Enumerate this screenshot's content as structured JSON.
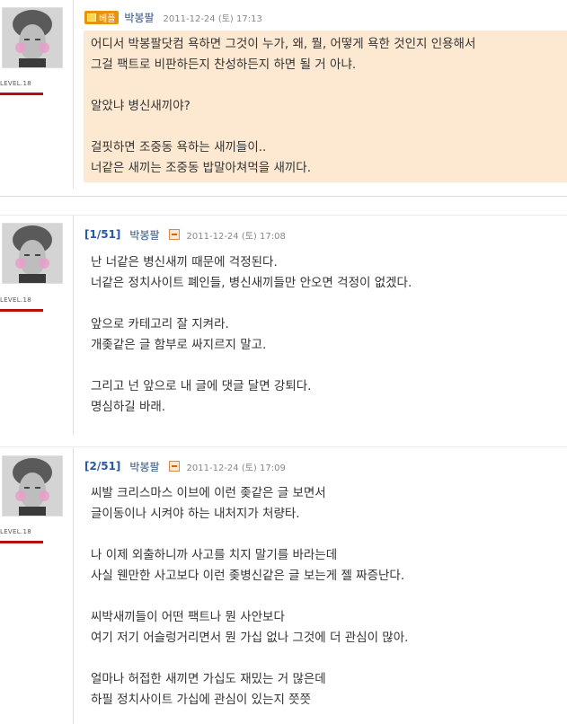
{
  "posts": [
    {
      "badge": "베플",
      "author": "박봉팔",
      "date": "2011-12-24 (토) 17:13",
      "level": "LEVEL.18",
      "lines": [
        "어디서 박봉팔닷컴 욕하면 그것이 누가, 왜, 뭘, 어떻게 욕한 것인지 인용해서",
        "그걸 팩트로 비판하든지 찬성하든지 하면 될 거 아냐.",
        "",
        "알았냐 병신새끼야?",
        "",
        "걸핏하면 조중동 욕하는 새끼들이..",
        "너같은 새끼는 조중동 밥말아쳐먹을 새끼다."
      ]
    },
    {
      "num": "[1/51]",
      "author": "박봉팔",
      "date": "2011-12-24 (토) 17:08",
      "level": "LEVEL.18",
      "lines": [
        "난 너같은 병신새끼 때문에 걱정된다.",
        "너같은 정치사이트 폐인들, 병신새끼들만 안오면 걱정이 없겠다.",
        "",
        "앞으로 카테고리 잘 지켜라.",
        "개좆같은 글 함부로 싸지르지 말고.",
        "",
        "그리고 넌 앞으로 내 글에 댓글 달면 강퇴다.",
        "명심하길 바래."
      ]
    },
    {
      "num": "[2/51]",
      "author": "박봉팔",
      "date": "2011-12-24 (토) 17:09",
      "level": "LEVEL.18",
      "lines": [
        "씨발 크리스마스 이브에 이런 좆같은 글 보면서",
        "글이동이나 시켜야 하는 내처지가 처량타.",
        "",
        "나 이제 외출하니까 사고를 치지 말기를 바라는데",
        "사실 웬만한 사고보다 이런 좆병신같은 글 보는게 젤 짜증난다.",
        "",
        "씨박새끼들이 어떤 팩트나 뭔 사안보다",
        "여기 저기 어슬렁거리면서 뭔 가십 없나 그것에 더 관심이 많아.",
        "",
        "얼마나 허접한 새끼면 가십도 재밌는 거 많은데",
        "하필 정치사이트 가십에 관심이 있는지  쯧쯧"
      ]
    }
  ]
}
